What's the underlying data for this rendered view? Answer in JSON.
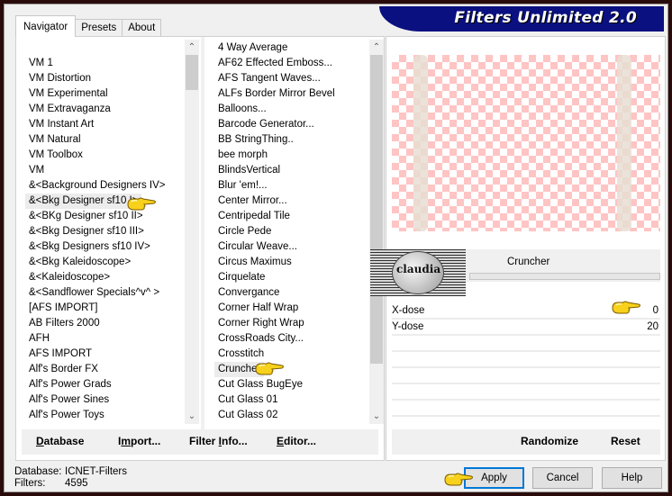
{
  "app": {
    "title": "Filters Unlimited 2.0",
    "accent_color": "#0a1080"
  },
  "tabs": [
    {
      "label": "Navigator",
      "active": true
    },
    {
      "label": "Presets",
      "active": false
    },
    {
      "label": "About",
      "active": false
    }
  ],
  "categories": {
    "selected": "&<Bkg Designer sf10 I>",
    "items": [
      "VM 1",
      "VM Distortion",
      "VM Experimental",
      "VM Extravaganza",
      "VM Instant Art",
      "VM Natural",
      "VM Toolbox",
      "VM",
      "&<Background Designers IV>",
      "&<Bkg Designer sf10 I>",
      "&<BKg Designer sf10 II>",
      "&<Bkg Designer sf10 III>",
      "&<Bkg Designers sf10 IV>",
      "&<Bkg Kaleidoscope>",
      "&<Kaleidoscope>",
      "&<Sandflower Specials^v^ >",
      "[AFS IMPORT]",
      "AB Filters 2000",
      "AFH",
      "AFS IMPORT",
      "Alf's Border FX",
      "Alf's Power Grads",
      "Alf's Power Sines",
      "Alf's Power Toys"
    ]
  },
  "filters": {
    "selected": "Cruncher",
    "items": [
      "4 Way Average",
      "AF62 Effected Emboss...",
      "AFS Tangent Waves...",
      "ALFs Border Mirror Bevel",
      "Balloons...",
      "Barcode Generator...",
      "BB StringThing..",
      "bee morph",
      "BlindsVertical",
      "Blur 'em!...",
      "Center Mirror...",
      "Centripedal Tile",
      "Circle Pede",
      "Circular Weave...",
      "Circus Maximus",
      "Cirquelate",
      "Convergance",
      "Corner Half Wrap",
      "Corner Right Wrap",
      "CrossRoads City...",
      "Crosstitch",
      "Cruncher",
      "Cut Glass  BugEye",
      "Cut Glass 01",
      "Cut Glass 02"
    ]
  },
  "list_buttons": {
    "database": "Database",
    "import": "Import...",
    "filter_info": "Filter Info...",
    "editor": "Editor..."
  },
  "filter_panel": {
    "name": "Cruncher",
    "logo_text": "claudia",
    "params": [
      {
        "label": "X-dose",
        "value": "0"
      },
      {
        "label": "Y-dose",
        "value": "20"
      }
    ],
    "randomize": "Randomize",
    "reset": "Reset"
  },
  "status": {
    "database_label": "Database:",
    "database_value": "ICNET-Filters",
    "filters_label": "Filters:",
    "filters_value": "4595"
  },
  "dialog_buttons": {
    "apply": "Apply",
    "cancel": "Cancel",
    "help": "Help"
  }
}
